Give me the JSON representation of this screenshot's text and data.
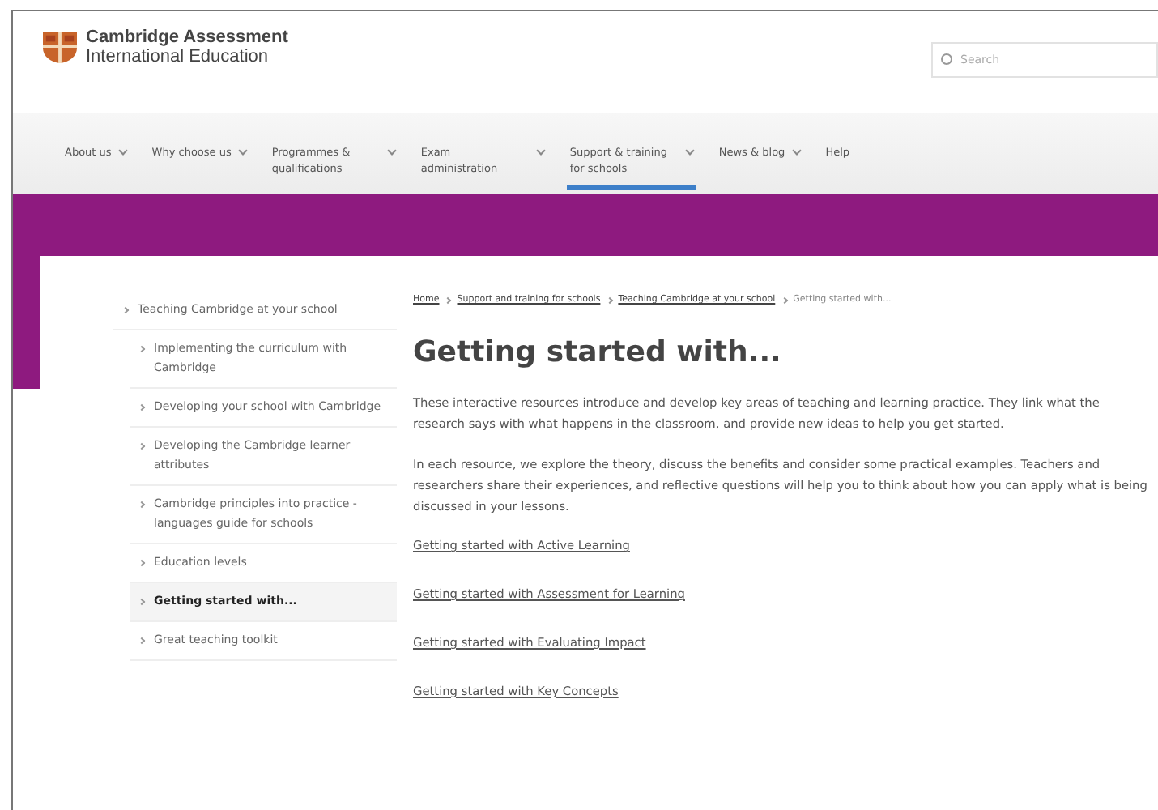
{
  "header": {
    "logo_line_1": "Cambridge Assessment",
    "logo_line_2": "International Education",
    "search": {
      "placeholder": "Search"
    }
  },
  "nav": [
    {
      "label": "About us",
      "menu": true,
      "selected": false
    },
    {
      "label": "Why choose us",
      "menu": true,
      "selected": false
    },
    {
      "label": "Programmes & qualifications",
      "menu": true,
      "selected": false
    },
    {
      "label": "Exam administration",
      "menu": true,
      "selected": false
    },
    {
      "label": "Support & training for schools",
      "menu": true,
      "selected": true
    },
    {
      "label": "News & blog",
      "menu": true,
      "selected": false
    },
    {
      "label": "Help",
      "menu": false,
      "selected": false
    }
  ],
  "sidebar": {
    "items": [
      {
        "label": "Teaching Cambridge at your school",
        "selected": false,
        "children": [
          {
            "label": "Implementing the curriculum with Cambridge",
            "selected": false
          },
          {
            "label": "Developing your school with Cambridge",
            "selected": false
          },
          {
            "label": "Developing the Cambridge learner attributes",
            "selected": false
          },
          {
            "label": "Cambridge principles into practice - languages guide for schools",
            "selected": false
          },
          {
            "label": "Education levels",
            "selected": false
          },
          {
            "label": "Getting started with...",
            "selected": true
          },
          {
            "label": "Great teaching toolkit",
            "selected": false
          }
        ]
      }
    ]
  },
  "breadcrumb": [
    {
      "label": "Home",
      "link": true
    },
    {
      "label": "Support and training for schools",
      "link": true
    },
    {
      "label": "Teaching Cambridge at your school",
      "link": true
    },
    {
      "label": "Getting started with...",
      "link": false
    }
  ],
  "title": "Getting started with...",
  "paragraphs": [
    "These interactive resources introduce and develop key areas of teaching and learning practice. They link what the research says with what happens in the classroom, and provide new ideas to help you get started.",
    "In each resource, we explore the theory, discuss the benefits and consider some practical examples. Teachers and researchers share their experiences, and reflective questions will help you to think about how you can apply what is being discussed in your lessons."
  ],
  "links": [
    "Getting started with Active Learning",
    "Getting started with Assessment for Learning",
    "Getting started with Evaluating Impact",
    "Getting started with Key Concepts"
  ]
}
